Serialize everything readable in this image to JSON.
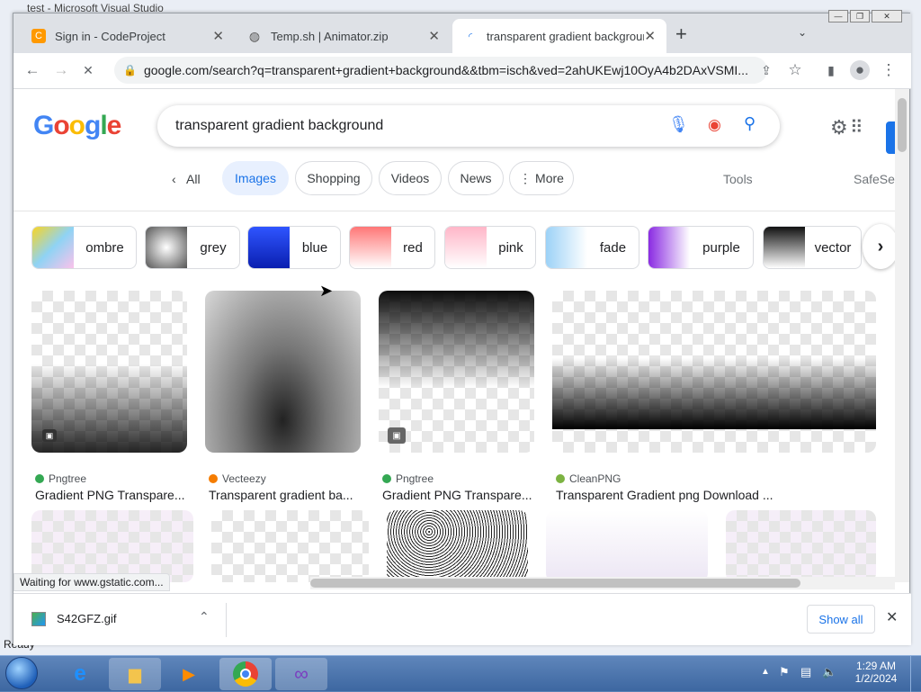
{
  "background": {
    "title": "test - Microsoft Visual Studio",
    "status": "Ready"
  },
  "tabs": [
    {
      "label": "Sign in - CodeProject"
    },
    {
      "label": "Temp.sh | Animator.zip"
    },
    {
      "label": "transparent gradient background"
    }
  ],
  "address": {
    "url": "google.com/search?q=transparent+gradient+background&&tbm=isch&ved=2ahUKEwj10OyA4b2DAxVSMI..."
  },
  "search": {
    "query": "transparent gradient background"
  },
  "nav": {
    "all": "All",
    "images": "Images",
    "shopping": "Shopping",
    "videos": "Videos",
    "news": "News",
    "more": "More",
    "tools": "Tools",
    "safesearch": "SafeSe"
  },
  "related": [
    "ombre",
    "grey",
    "blue",
    "red",
    "pink",
    "fade",
    "purple",
    "vector"
  ],
  "results": [
    {
      "source": "Pngtree",
      "caption": "Gradient PNG Transpare..."
    },
    {
      "source": "Vecteezy",
      "caption": "Transparent gradient ba..."
    },
    {
      "source": "Pngtree",
      "caption": "Gradient PNG Transpare..."
    },
    {
      "source": "CleanPNG",
      "caption": "Transparent Gradient png Download ..."
    }
  ],
  "status": {
    "text": "Waiting for www.gstatic.com..."
  },
  "download": {
    "file": "S42GFZ.gif",
    "show_all": "Show all"
  },
  "clock": {
    "time": "1:29 AM",
    "date": "1/2/2024"
  }
}
